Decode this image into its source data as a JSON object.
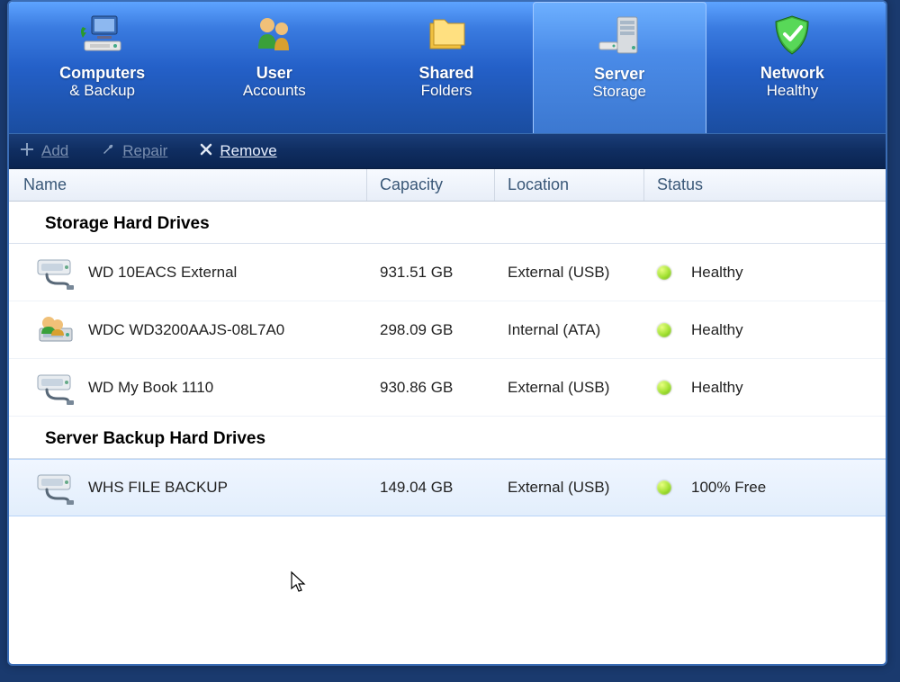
{
  "nav": [
    {
      "title": "Computers",
      "subtitle": "& Backup",
      "icon": "computers",
      "active": false
    },
    {
      "title": "User",
      "subtitle": "Accounts",
      "icon": "users",
      "active": false
    },
    {
      "title": "Shared",
      "subtitle": "Folders",
      "icon": "folders",
      "active": false
    },
    {
      "title": "Server",
      "subtitle": "Storage",
      "icon": "server",
      "active": true
    },
    {
      "title": "Network",
      "subtitle": "Healthy",
      "icon": "shield",
      "active": false
    }
  ],
  "toolbar": {
    "add": {
      "label": "Add",
      "enabled": false
    },
    "repair": {
      "label": "Repair",
      "enabled": false
    },
    "remove": {
      "label": "Remove",
      "enabled": true
    }
  },
  "columns": {
    "name": "Name",
    "capacity": "Capacity",
    "location": "Location",
    "status": "Status"
  },
  "groups": [
    {
      "title": "Storage Hard Drives",
      "rows": [
        {
          "icon": "ext",
          "name": "WD 10EACS External",
          "capacity": "931.51 GB",
          "location": "External (USB)",
          "status": "Healthy",
          "selected": false
        },
        {
          "icon": "int",
          "name": "WDC WD3200AAJS-08L7A0",
          "capacity": "298.09 GB",
          "location": "Internal (ATA)",
          "status": "Healthy",
          "selected": false
        },
        {
          "icon": "ext",
          "name": "WD My Book 1110",
          "capacity": "930.86 GB",
          "location": "External (USB)",
          "status": "Healthy",
          "selected": false
        }
      ]
    },
    {
      "title": "Server Backup Hard Drives",
      "rows": [
        {
          "icon": "ext",
          "name": "WHS FILE BACKUP",
          "capacity": "149.04 GB",
          "location": "External (USB)",
          "status": "100% Free",
          "selected": true
        }
      ]
    }
  ]
}
